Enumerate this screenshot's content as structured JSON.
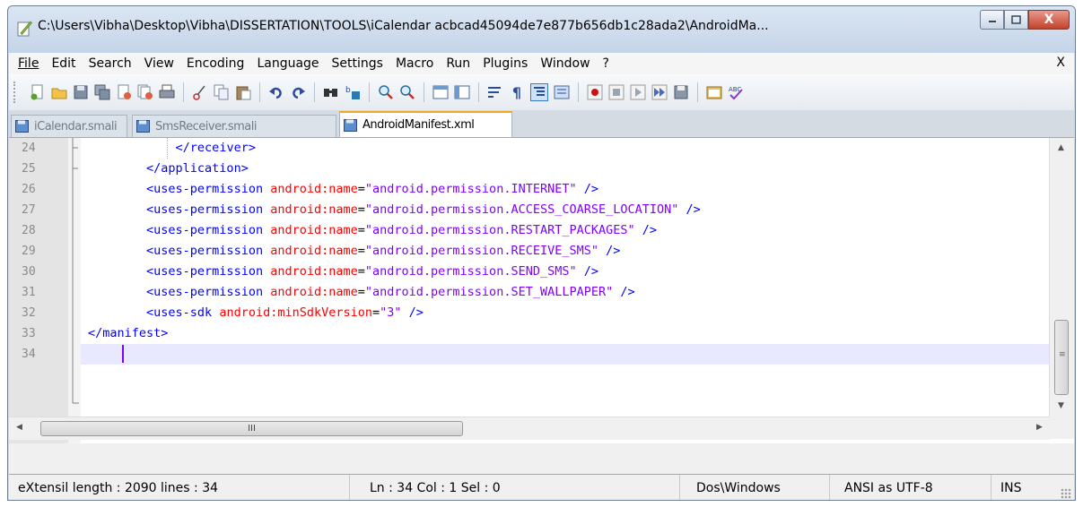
{
  "window": {
    "title": "C:\\Users\\Vibha\\Desktop\\Vibha\\DISSERTATION\\TOOLS\\iCalendar acbcad45094de7e877b656db1c28ada2\\AndroidMa...",
    "close_label": "X"
  },
  "menu": {
    "items": [
      "File",
      "Edit",
      "Search",
      "View",
      "Encoding",
      "Language",
      "Settings",
      "Macro",
      "Run",
      "Plugins",
      "Window",
      "?"
    ],
    "close": "X"
  },
  "toolbar": {
    "icons": [
      "new-file-icon",
      "open-file-icon",
      "save-icon",
      "save-all-icon",
      "close-icon",
      "close-all-icon",
      "print-icon",
      "cut-icon",
      "copy-icon",
      "paste-icon",
      "undo-icon",
      "redo-icon",
      "find-icon",
      "replace-icon",
      "zoom-in-icon",
      "zoom-out-icon",
      "sync-vertical-icon",
      "sync-horizontal-icon",
      "word-wrap-icon",
      "show-all-characters-icon",
      "indent-guide-icon",
      "user-defined-language-icon",
      "record-macro-icon",
      "stop-macro-icon",
      "play-macro-icon",
      "run-macro-multiple-icon",
      "save-macro-icon",
      "launch-browser-icon",
      "spell-check-icon"
    ]
  },
  "tabs": [
    {
      "label": "iCalendar.smali",
      "active": false
    },
    {
      "label": "SmsReceiver.smali",
      "active": false
    },
    {
      "label": "AndroidManifest.xml",
      "active": true
    }
  ],
  "editor": {
    "lines": [
      {
        "num": "24",
        "parts": [
          {
            "t": "            ",
            "c": "eq"
          },
          {
            "t": "</receiver>",
            "c": "tag"
          }
        ]
      },
      {
        "num": "25",
        "parts": [
          {
            "t": "        ",
            "c": "eq"
          },
          {
            "t": "</application>",
            "c": "tag"
          }
        ]
      },
      {
        "num": "26",
        "parts": [
          {
            "t": "        ",
            "c": "eq"
          },
          {
            "t": "<uses-permission ",
            "c": "tag"
          },
          {
            "t": "android:name",
            "c": "attr"
          },
          {
            "t": "=",
            "c": "eq"
          },
          {
            "t": "\"android.permission.INTERNET\"",
            "c": "str"
          },
          {
            "t": " />",
            "c": "tag"
          }
        ]
      },
      {
        "num": "27",
        "parts": [
          {
            "t": "        ",
            "c": "eq"
          },
          {
            "t": "<uses-permission ",
            "c": "tag"
          },
          {
            "t": "android:name",
            "c": "attr"
          },
          {
            "t": "=",
            "c": "eq"
          },
          {
            "t": "\"android.permission.ACCESS_COARSE_LOCATION\"",
            "c": "str"
          },
          {
            "t": " />",
            "c": "tag"
          }
        ]
      },
      {
        "num": "28",
        "parts": [
          {
            "t": "        ",
            "c": "eq"
          },
          {
            "t": "<uses-permission ",
            "c": "tag"
          },
          {
            "t": "android:name",
            "c": "attr"
          },
          {
            "t": "=",
            "c": "eq"
          },
          {
            "t": "\"android.permission.RESTART_PACKAGES\"",
            "c": "str"
          },
          {
            "t": " />",
            "c": "tag"
          }
        ]
      },
      {
        "num": "29",
        "parts": [
          {
            "t": "        ",
            "c": "eq"
          },
          {
            "t": "<uses-permission ",
            "c": "tag"
          },
          {
            "t": "android:name",
            "c": "attr"
          },
          {
            "t": "=",
            "c": "eq"
          },
          {
            "t": "\"android.permission.RECEIVE_SMS\"",
            "c": "str"
          },
          {
            "t": " />",
            "c": "tag"
          }
        ]
      },
      {
        "num": "30",
        "parts": [
          {
            "t": "        ",
            "c": "eq"
          },
          {
            "t": "<uses-permission ",
            "c": "tag"
          },
          {
            "t": "android:name",
            "c": "attr"
          },
          {
            "t": "=",
            "c": "eq"
          },
          {
            "t": "\"android.permission.SEND_SMS\"",
            "c": "str"
          },
          {
            "t": " />",
            "c": "tag"
          }
        ]
      },
      {
        "num": "31",
        "parts": [
          {
            "t": "        ",
            "c": "eq"
          },
          {
            "t": "<uses-permission ",
            "c": "tag"
          },
          {
            "t": "android:name",
            "c": "attr"
          },
          {
            "t": "=",
            "c": "eq"
          },
          {
            "t": "\"android.permission.SET_WALLPAPER\"",
            "c": "str"
          },
          {
            "t": " />",
            "c": "tag"
          }
        ]
      },
      {
        "num": "32",
        "parts": [
          {
            "t": "        ",
            "c": "eq"
          },
          {
            "t": "<uses-sdk ",
            "c": "tag"
          },
          {
            "t": "android:minSdkVersion",
            "c": "attr"
          },
          {
            "t": "=",
            "c": "eq"
          },
          {
            "t": "\"3\"",
            "c": "str"
          },
          {
            "t": " />",
            "c": "tag"
          }
        ]
      },
      {
        "num": "33",
        "parts": [
          {
            "t": "</manifest>",
            "c": "tag"
          }
        ]
      },
      {
        "num": "34",
        "parts": []
      }
    ],
    "hscroll_thumb": "III"
  },
  "status": {
    "doc_type": "eXtensil length : 2090    lines : 34",
    "position": "Ln : 34    Col : 1    Sel : 0",
    "eol": "Dos\\Windows",
    "encoding": "ANSI as UTF-8",
    "mode": "INS"
  }
}
